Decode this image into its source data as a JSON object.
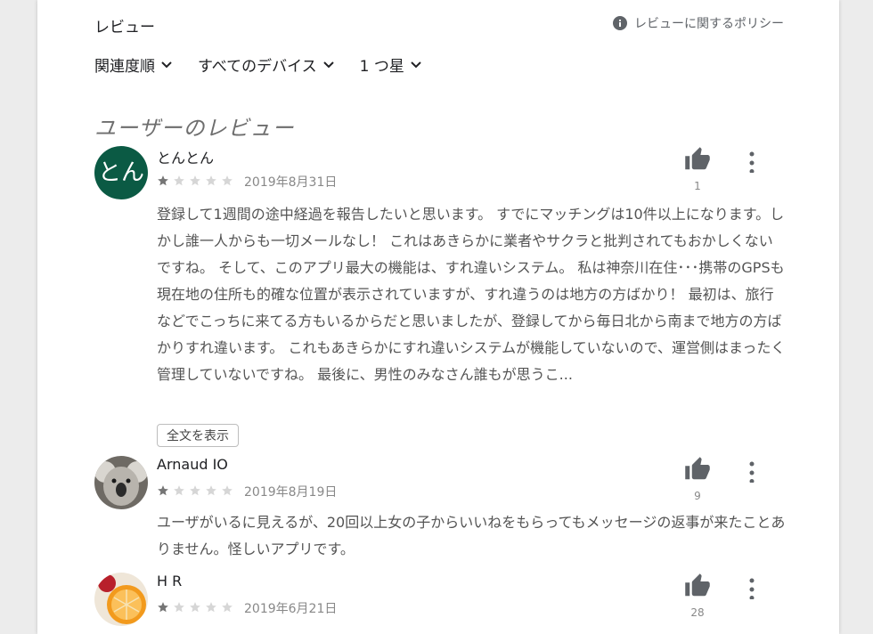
{
  "header": {
    "title": "レビュー",
    "policy_link": "レビューに関するポリシー"
  },
  "filters": [
    {
      "label": "関連度順"
    },
    {
      "label": "すべてのデバイス"
    },
    {
      "label": "1 つ星"
    }
  ],
  "users_heading": "ユーザーのレビュー",
  "reviews": [
    {
      "avatar_text": "とん",
      "author": "とんとん",
      "rating": 1,
      "max_rating": 5,
      "date": "2019年8月31日",
      "helpful_count": "1",
      "text": "登録して1週間の途中経過を報告したいと思います。 すでにマッチングは10件以上になります。しかし誰一人からも一切メールなし！ これはあきらかに業者やサクラと批判されてもおかしくないですね。 そして、このアプリ最大の機能は、すれ違いシステム。 私は神奈川在住･･･携帯のGPSも現在地の住所も的確な位置が表示されていますが、すれ違うのは地方の方ばかり！ 最初は、旅行などでこっちに来てる方もいるからだと思いましたが、登録してから毎日北から南まで地方の方ばかりすれ違います。 これもあきらかにすれ違いシステムが機能していないので、運営側はまったく管理していないですね。 最後に、男性のみなさん誰もが思うこ...",
      "full_text_button": "全文を表示"
    },
    {
      "avatar": "koala-photo",
      "author": "Arnaud IO",
      "rating": 1,
      "max_rating": 5,
      "date": "2019年8月19日",
      "helpful_count": "9",
      "text": "ユーザがいるに見えるが、20回以上女の子からいいねをもらってもメッセージの返事が来たことありません。怪しいアプリです。"
    },
    {
      "avatar": "orange-photo",
      "author": "H R",
      "rating": 1,
      "max_rating": 5,
      "date": "2019年6月21日",
      "helpful_count": "28",
      "text": ""
    }
  ],
  "colors": {
    "star_filled": "#757575",
    "star_empty": "#d6d6d6",
    "avatar_bg": "#0b5a44"
  }
}
